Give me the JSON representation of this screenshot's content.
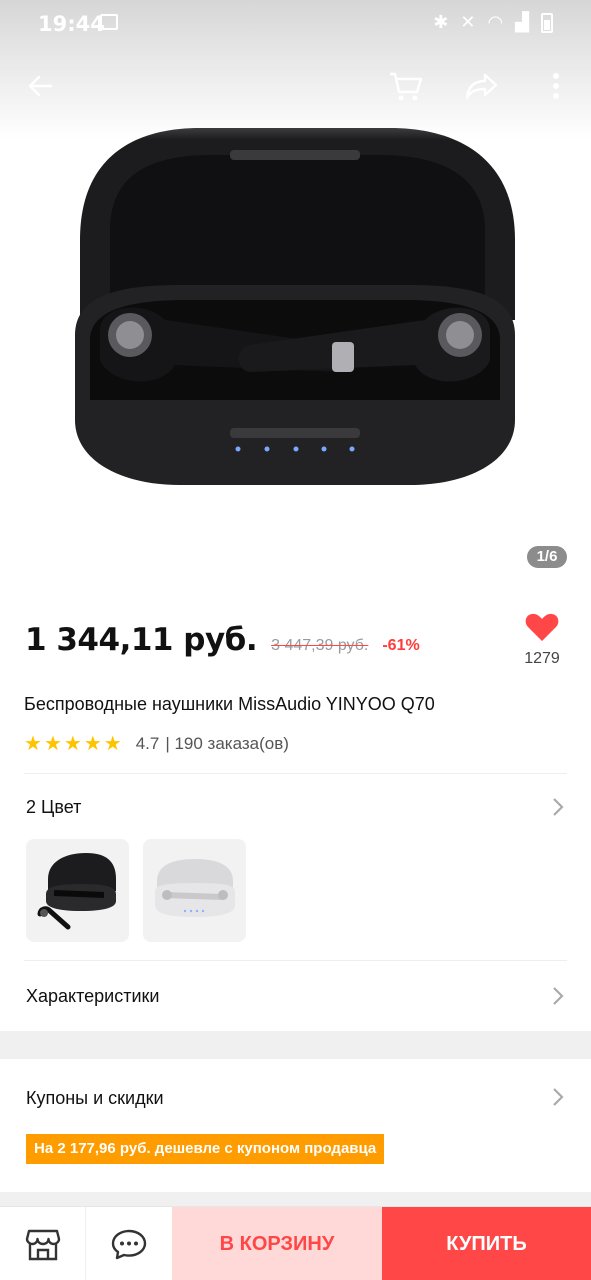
{
  "status_bar": {
    "time": "19:44"
  },
  "gallery": {
    "page_indicator": "1/6"
  },
  "price": {
    "current": "1 344,11 руб.",
    "old": "3 447,39 руб.",
    "discount": "-61%"
  },
  "favorites": {
    "count": "1279"
  },
  "product": {
    "title": "Беспроводные наушники MissAudio YINYOO Q70",
    "rating": "4.7",
    "orders": "| 190 заказа(ов)",
    "stars": 5
  },
  "colors": {
    "label": "2 Цвет",
    "options": [
      "black",
      "white"
    ]
  },
  "specs": {
    "label": "Характеристики"
  },
  "coupons": {
    "label": "Купоны и скидки",
    "banner": "На 2 177,96 руб. дешевле с купоном продавца"
  },
  "actions": {
    "add_to_cart": "В КОРЗИНУ",
    "buy": "КУПИТЬ"
  },
  "theme": {
    "accent": "#ff4747",
    "cart_bg": "#ffd8d8",
    "coupon": "#ff9c00",
    "star": "#ffc400"
  }
}
